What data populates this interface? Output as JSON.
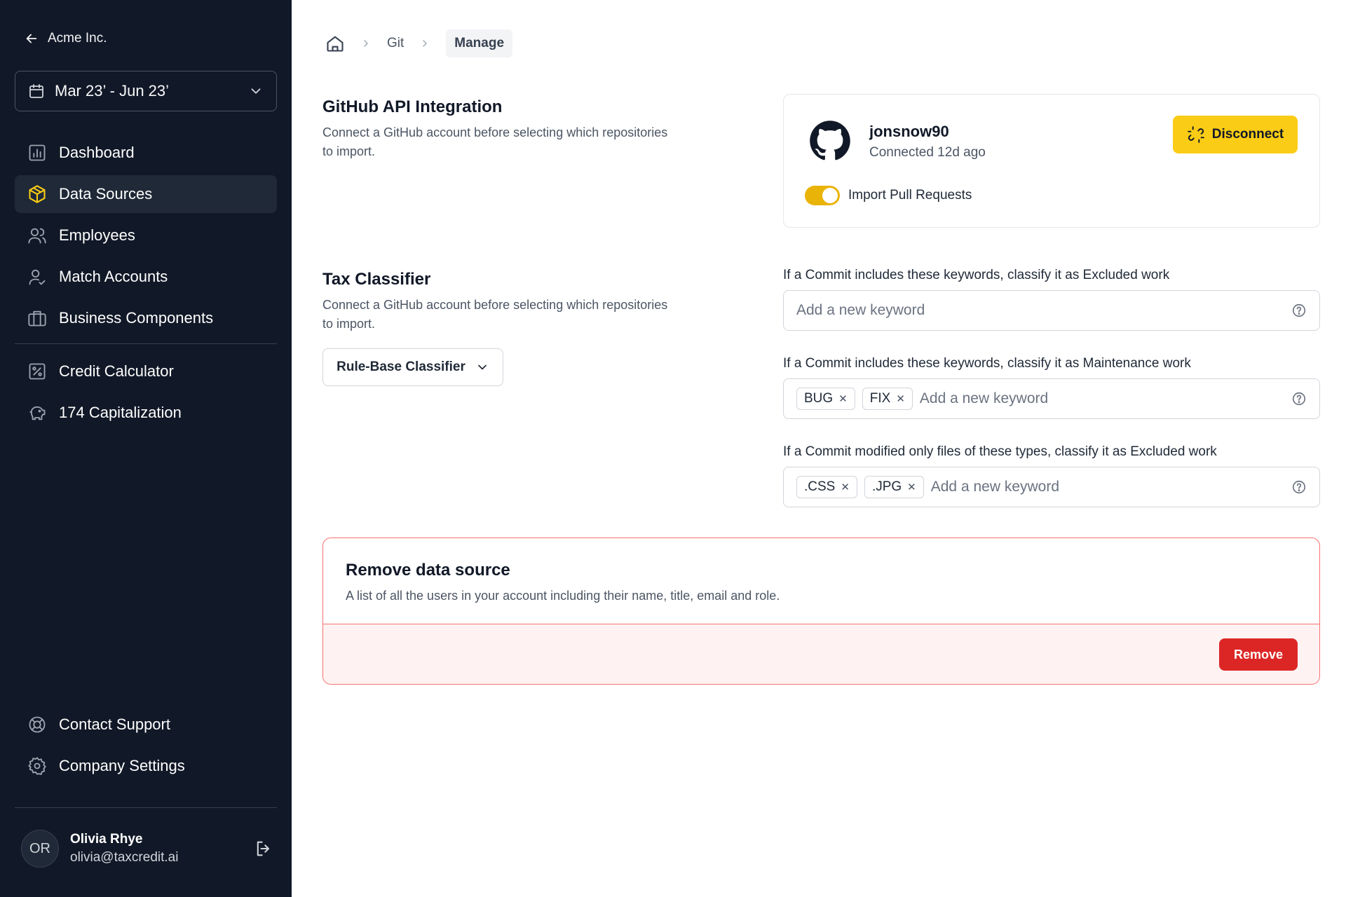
{
  "sidebar": {
    "back_label": "Acme Inc.",
    "date_range": "Mar 23’ - Jun 23’",
    "primary_nav": [
      {
        "label": "Dashboard",
        "icon": "chart-icon",
        "active": false
      },
      {
        "label": "Data Sources",
        "icon": "cube-icon",
        "active": true
      },
      {
        "label": "Employees",
        "icon": "users-icon",
        "active": false
      },
      {
        "label": "Match Accounts",
        "icon": "user-check-icon",
        "active": false
      },
      {
        "label": "Business Components",
        "icon": "briefcase-icon",
        "active": false
      }
    ],
    "secondary_nav": [
      {
        "label": "Credit Calculator",
        "icon": "percent-icon"
      },
      {
        "label": "174 Capitalization",
        "icon": "piggy-bank-icon"
      }
    ],
    "footer_nav": [
      {
        "label": "Contact Support",
        "icon": "lifebuoy-icon"
      },
      {
        "label": "Company Settings",
        "icon": "gear-icon"
      }
    ],
    "user": {
      "initials": "OR",
      "name": "Olivia Rhye",
      "email": "olivia@taxcredit.ai"
    }
  },
  "breadcrumb": {
    "items": [
      "Git",
      "Manage"
    ]
  },
  "github": {
    "title": "GitHub API Integration",
    "description": "Connect a GitHub account before selecting which repositories to import.",
    "username": "jonsnow90",
    "status": "Connected 12d ago",
    "disconnect_label": "Disconnect",
    "toggle_label": "Import Pull Requests",
    "toggle_on": true
  },
  "tax_classifier": {
    "title": "Tax Classifier",
    "description": "Connect a GitHub account before selecting which repositories to import.",
    "classifier_label": "Rule-Base Classifier"
  },
  "keyword_fields": [
    {
      "label": "If a Commit includes these keywords, classify it as Excluded work",
      "tags": [],
      "placeholder": "Add a new keyword"
    },
    {
      "label": "If a Commit includes these keywords, classify it as Maintenance work",
      "tags": [
        "BUG",
        "FIX"
      ],
      "placeholder": "Add a new keyword"
    },
    {
      "label": "If a Commit modified only files of these types, classify it as Excluded work",
      "tags": [
        ".CSS",
        ".JPG"
      ],
      "placeholder": "Add a new keyword"
    }
  ],
  "danger": {
    "title": "Remove data source",
    "description": "A list of all the users in your account including their name, title, email and role.",
    "remove_label": "Remove"
  },
  "colors": {
    "sidebar_bg": "#111827",
    "accent": "#facc15",
    "danger": "#dc2626"
  }
}
